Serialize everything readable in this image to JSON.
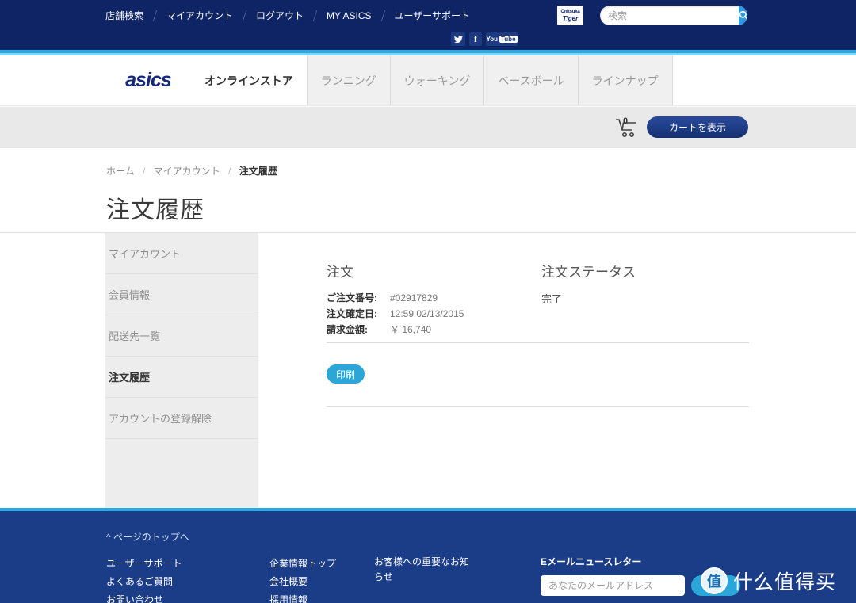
{
  "topbar": {
    "util_links": [
      "店舗検索",
      "マイアカウント",
      "ログアウト",
      "MY ASICS",
      "ユーザーサポート"
    ],
    "onitsuka_logo_top": "Onitsuka",
    "onitsuka_logo_bottom": "Tiger",
    "search": {
      "value": "",
      "placeholder": "検索",
      "icon": "search-icon",
      "button_color": "#2f9ae0"
    },
    "social": [
      {
        "name": "twitter-icon",
        "label": "Twitter"
      },
      {
        "name": "facebook-icon",
        "label": "f"
      },
      {
        "name": "youtube-icon",
        "label_you": "You",
        "label_tube": "Tube"
      }
    ],
    "background": "#0e2464"
  },
  "mainnav": {
    "brand": "asics",
    "tabs": [
      {
        "label": "オンラインストア",
        "active": true
      },
      {
        "label": "ランニング",
        "active": false
      },
      {
        "label": "ウォーキング",
        "active": false
      },
      {
        "label": "ベースボール",
        "active": false
      },
      {
        "label": "ラインナップ",
        "active": false
      }
    ]
  },
  "cartband": {
    "cart_count": "0",
    "cart_button": "カートを表示"
  },
  "breadcrumb": {
    "items": [
      "ホーム",
      "マイアカウント",
      "注文履歴"
    ],
    "separator": "/"
  },
  "page": {
    "title": "注文履歴"
  },
  "sidebar": {
    "items": [
      {
        "label": "マイアカウント",
        "active": false
      },
      {
        "label": "会員情報",
        "active": false
      },
      {
        "label": "配送先一覧",
        "active": false
      },
      {
        "label": "注文履歴",
        "active": true
      },
      {
        "label": "アカウントの登録解除",
        "active": false
      }
    ]
  },
  "order": {
    "section_title": "注文",
    "rows": [
      {
        "label": "ご注文番号:",
        "value": "#02917829"
      },
      {
        "label": "注文確定日:",
        "value": "12:59 02/13/2015"
      },
      {
        "label": "請求金額:",
        "value": "￥ 16,740"
      }
    ],
    "print_button": "印刷"
  },
  "status": {
    "section_title": "注文ステータス",
    "value": "完了"
  },
  "footer": {
    "to_top": "^ ページのトップへ",
    "col1": [
      "ユーザーサポート",
      "よくあるご質問",
      "お問い合わせ"
    ],
    "col2": [
      "企業情報トップ",
      "会社概要",
      "採用情報"
    ],
    "col3": [
      "お客様への重要なお知らせ"
    ],
    "newsletter": {
      "heading": "Eメールニュースレター",
      "input_value": "",
      "input_placeholder": "あなたのメールアドレス",
      "button": "登録"
    },
    "background": "#1b3c87",
    "accent": "#29abe2"
  },
  "watermark": {
    "badge": "值",
    "text": "什么值得买"
  }
}
